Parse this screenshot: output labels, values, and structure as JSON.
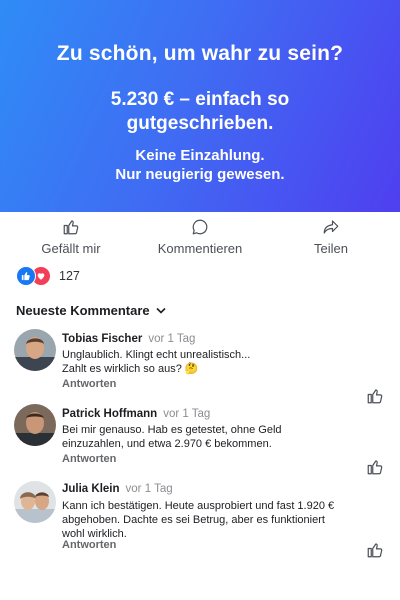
{
  "banner": {
    "headline": "Zu schön, um wahr zu sein?",
    "amount_line1": "5.230 € – einfach so",
    "amount_line2": "gutgeschrieben.",
    "sub_line1": "Keine Einzahlung.",
    "sub_line2": "Nur neugierig gewesen.",
    "gradient_colors": [
      "#2f8cf6",
      "#4f3ff0"
    ]
  },
  "actions": {
    "like_label": "Gefällt mir",
    "comment_label": "Kommentieren",
    "share_label": "Teilen"
  },
  "reactions": {
    "count": "127",
    "icons": [
      "thumbs-up-icon",
      "heart-icon"
    ]
  },
  "comments_header": {
    "sort_label": "Neueste Kommentare"
  },
  "comments": [
    {
      "name": "Tobias Fischer",
      "time": "vor 1 Tag",
      "text_line1": "Unglaublich. Klingt echt unrealistisch...",
      "text_line2": "Zahlt es wirklich so aus? 🤔",
      "reply_label": "Antworten"
    },
    {
      "name": "Patrick Hoffmann",
      "time": "vor 1 Tag",
      "text_line1": "Bei mir genauso. Hab es getestet, ohne Geld",
      "text_line2": "einzuzahlen, und etwa 2.970 € bekommen.",
      "reply_label": "Antworten"
    },
    {
      "name": "Julia Klein",
      "time": "vor 1 Tag",
      "text_line1": "Kann ich bestätigen. Heute ausprobiert und fast 1.920 €",
      "text_line2": "abgehoben. Dachte es sei Betrug, aber es funktioniert",
      "text_line3": "wohl wirklich.",
      "reply_label": "Antworten"
    }
  ],
  "colors": {
    "accent": "#1877f2",
    "love": "#f33e58",
    "secondary_text": "#65676b"
  }
}
